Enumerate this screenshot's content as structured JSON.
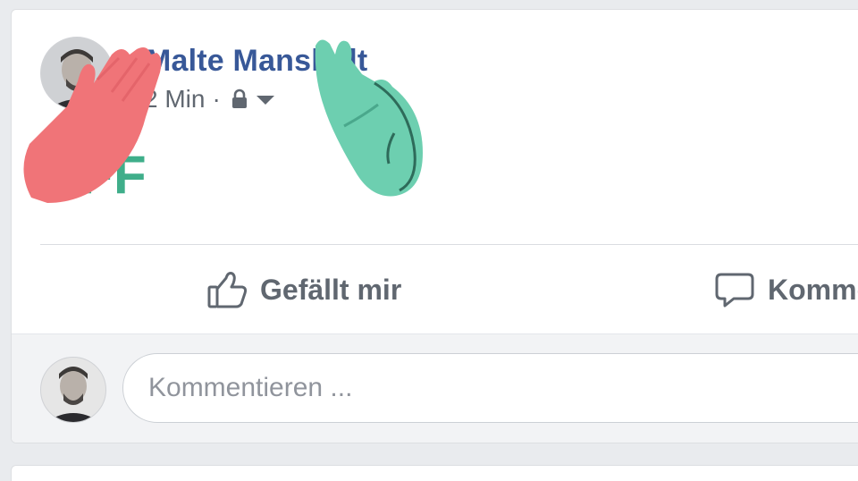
{
  "post": {
    "author_name": "Malte Mansholt",
    "timestamp": "2 Min",
    "separator": "·",
    "audience_icon": "lock-icon",
    "text": "BFF",
    "text_color": "#3fae8a"
  },
  "reactions": {
    "left_hand_icon": "raised-hand-red",
    "left_hand_color": "#f07478",
    "right_hand_icon": "raised-hand-teal",
    "right_hand_color": "#6dcfb0"
  },
  "actions": {
    "like_label": "Gefällt mir",
    "comment_label": "Kommentieren"
  },
  "comment_box": {
    "placeholder": "Kommentieren ..."
  },
  "colors": {
    "name_link": "#385898",
    "secondary_text": "#606770",
    "background": "#e9ebee"
  }
}
